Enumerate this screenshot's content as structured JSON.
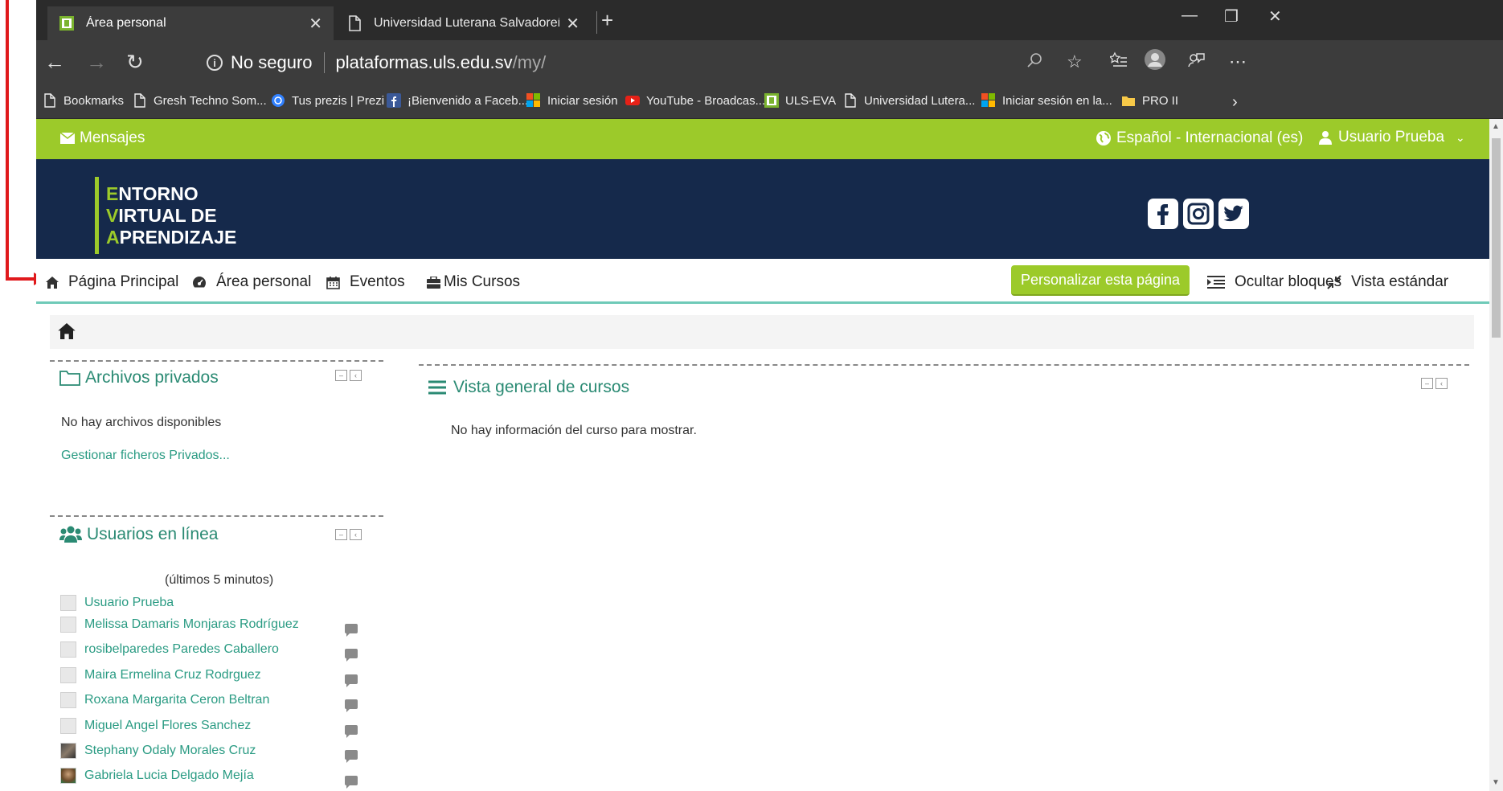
{
  "tabs": [
    {
      "label": "Área personal",
      "active": true
    },
    {
      "label": "Universidad Luterana Salvadoreñ",
      "active": false
    }
  ],
  "window_controls": {
    "minimize": "—",
    "restore": "❐",
    "close": "✕"
  },
  "address_bar": {
    "security_text": "No seguro",
    "url_domain": "plataformas.uls.edu.sv",
    "url_path": "/my/"
  },
  "bookmarks": [
    {
      "label": "Bookmarks",
      "icon": "page-icon"
    },
    {
      "label": "Gresh Techno Som...",
      "icon": "page-icon"
    },
    {
      "label": "Tus prezis | Prezi",
      "icon": "prezi-icon"
    },
    {
      "label": "¡Bienvenido a Faceb...",
      "icon": "facebook-icon"
    },
    {
      "label": "Iniciar sesión",
      "icon": "microsoft-icon"
    },
    {
      "label": "YouTube - Broadcas...",
      "icon": "youtube-icon"
    },
    {
      "label": "ULS-EVA",
      "icon": "uls-icon"
    },
    {
      "label": "Universidad Lutera...",
      "icon": "page-icon"
    },
    {
      "label": "Iniciar sesión en la...",
      "icon": "microsoft-icon"
    },
    {
      "label": "PRO II",
      "icon": "folder-icon"
    }
  ],
  "topbar": {
    "messages_label": "Mensajes",
    "language_label": "Español - Internacional (es)",
    "user_label": "Usuario Prueba"
  },
  "header": {
    "logo_lines": [
      {
        "first": "E",
        "rest": "NTORNO"
      },
      {
        "first": "V",
        "rest": "IRTUAL DE"
      },
      {
        "first": "A",
        "rest": "PRENDIZAJE"
      }
    ],
    "social_icons": [
      "facebook-icon",
      "instagram-icon",
      "twitter-icon"
    ]
  },
  "navbar": {
    "items": [
      {
        "label": "Página Principal",
        "icon": "home-icon"
      },
      {
        "label": "Área personal",
        "icon": "dashboard-icon"
      },
      {
        "label": "Eventos",
        "icon": "calendar-icon"
      },
      {
        "label": "Mis Cursos",
        "icon": "briefcase-icon"
      }
    ],
    "customize_button": "Personalizar esta página",
    "hide_blocks": "Ocultar bloques",
    "standard_view": "Vista estándar"
  },
  "blocks": {
    "private_files": {
      "title": "Archivos privados",
      "empty_text": "No hay archivos disponibles",
      "manage_link": "Gestionar ficheros Privados..."
    },
    "online_users": {
      "title": "Usuarios en línea",
      "subtitle": "(últimos 5 minutos)",
      "users": [
        {
          "name": "Usuario Prueba",
          "avatar": "default",
          "chat": false
        },
        {
          "name": "Melissa Damaris Monjaras Rodríguez",
          "avatar": "default",
          "chat": true
        },
        {
          "name": "rosibelparedes Paredes Caballero",
          "avatar": "default",
          "chat": true
        },
        {
          "name": "Maira Ermelina Cruz Rodrguez",
          "avatar": "default",
          "chat": true
        },
        {
          "name": "Roxana Margarita Ceron Beltran",
          "avatar": "default",
          "chat": true
        },
        {
          "name": "Miguel Angel Flores Sanchez",
          "avatar": "default",
          "chat": true
        },
        {
          "name": "Stephany Odaly Morales Cruz",
          "avatar": "photo1",
          "chat": true
        },
        {
          "name": "Gabriela Lucia Delgado Mejía",
          "avatar": "photo2",
          "chat": true
        }
      ]
    },
    "course_overview": {
      "title": "Vista general de cursos",
      "empty_text": "No hay información del curso para mostrar."
    }
  },
  "colors": {
    "accent_green": "#9cca2a",
    "header_navy": "#15294b",
    "link_teal": "#2a9b83",
    "annotation_red": "#e0191c"
  }
}
